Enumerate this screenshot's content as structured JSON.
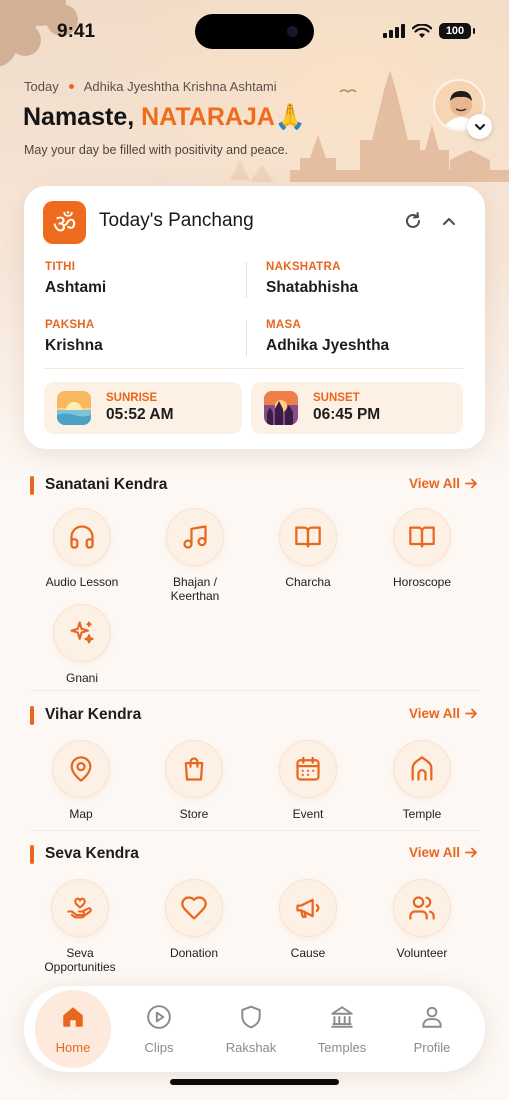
{
  "status_bar": {
    "time": "9:41",
    "battery": "100"
  },
  "header": {
    "today_label": "Today",
    "date_text": "Adhika Jyeshtha Krishna Ashtami",
    "greeting_prefix": "Namaste, ",
    "user_name": "NATARAJA",
    "greeting_emoji": "🙏",
    "subtitle": "May your day be filled with positivity and peace."
  },
  "panchang": {
    "om_symbol": "ॐ",
    "title": "Today's Panchang",
    "tithi": {
      "label": "TITHI",
      "value": "Ashtami"
    },
    "nakshatra": {
      "label": "NAKSHATRA",
      "value": "Shatabhisha"
    },
    "paksha": {
      "label": "PAKSHA",
      "value": "Krishna"
    },
    "masa": {
      "label": "MASA",
      "value": "Adhika Jyeshtha"
    },
    "sunrise": {
      "label": "SUNRISE",
      "value": "05:52 AM"
    },
    "sunset": {
      "label": "SUNSET",
      "value": "06:45 PM"
    }
  },
  "sanatani": {
    "title": "Sanatani Kendra",
    "view_all": "View All",
    "items": [
      {
        "label": "Audio Lesson",
        "icon": "headphones-icon"
      },
      {
        "label": "Bhajan / Keerthan",
        "icon": "music-note-icon"
      },
      {
        "label": "Charcha",
        "icon": "open-book-icon"
      },
      {
        "label": "Horoscope",
        "icon": "open-book-icon"
      },
      {
        "label": "Gnani",
        "icon": "sparkles-icon"
      }
    ]
  },
  "vihar": {
    "title": "Vihar Kendra",
    "view_all": "View All",
    "items": [
      {
        "label": "Map",
        "icon": "map-pin-icon"
      },
      {
        "label": "Store",
        "icon": "shopping-bag-icon"
      },
      {
        "label": "Event",
        "icon": "calendar-icon"
      },
      {
        "label": "Temple",
        "icon": "temple-icon"
      }
    ]
  },
  "seva": {
    "title": "Seva Kendra",
    "view_all": "View All",
    "items": [
      {
        "label": "Seva Opportunities",
        "icon": "hand-heart-icon"
      },
      {
        "label": "Donation",
        "icon": "heart-icon"
      },
      {
        "label": "Cause",
        "icon": "megaphone-icon"
      },
      {
        "label": "Volunteer",
        "icon": "users-icon"
      }
    ]
  },
  "nav": {
    "items": [
      {
        "label": "Home",
        "icon": "home-icon",
        "active": true
      },
      {
        "label": "Clips",
        "icon": "play-circle-icon"
      },
      {
        "label": "Rakshak",
        "icon": "shield-icon"
      },
      {
        "label": "Temples",
        "icon": "temple-columns-icon"
      },
      {
        "label": "Profile",
        "icon": "user-icon"
      }
    ]
  },
  "colors": {
    "accent": "#e8661e",
    "name_accent": "#ef6c1d",
    "nav_inactive": "#8b8b8b"
  }
}
